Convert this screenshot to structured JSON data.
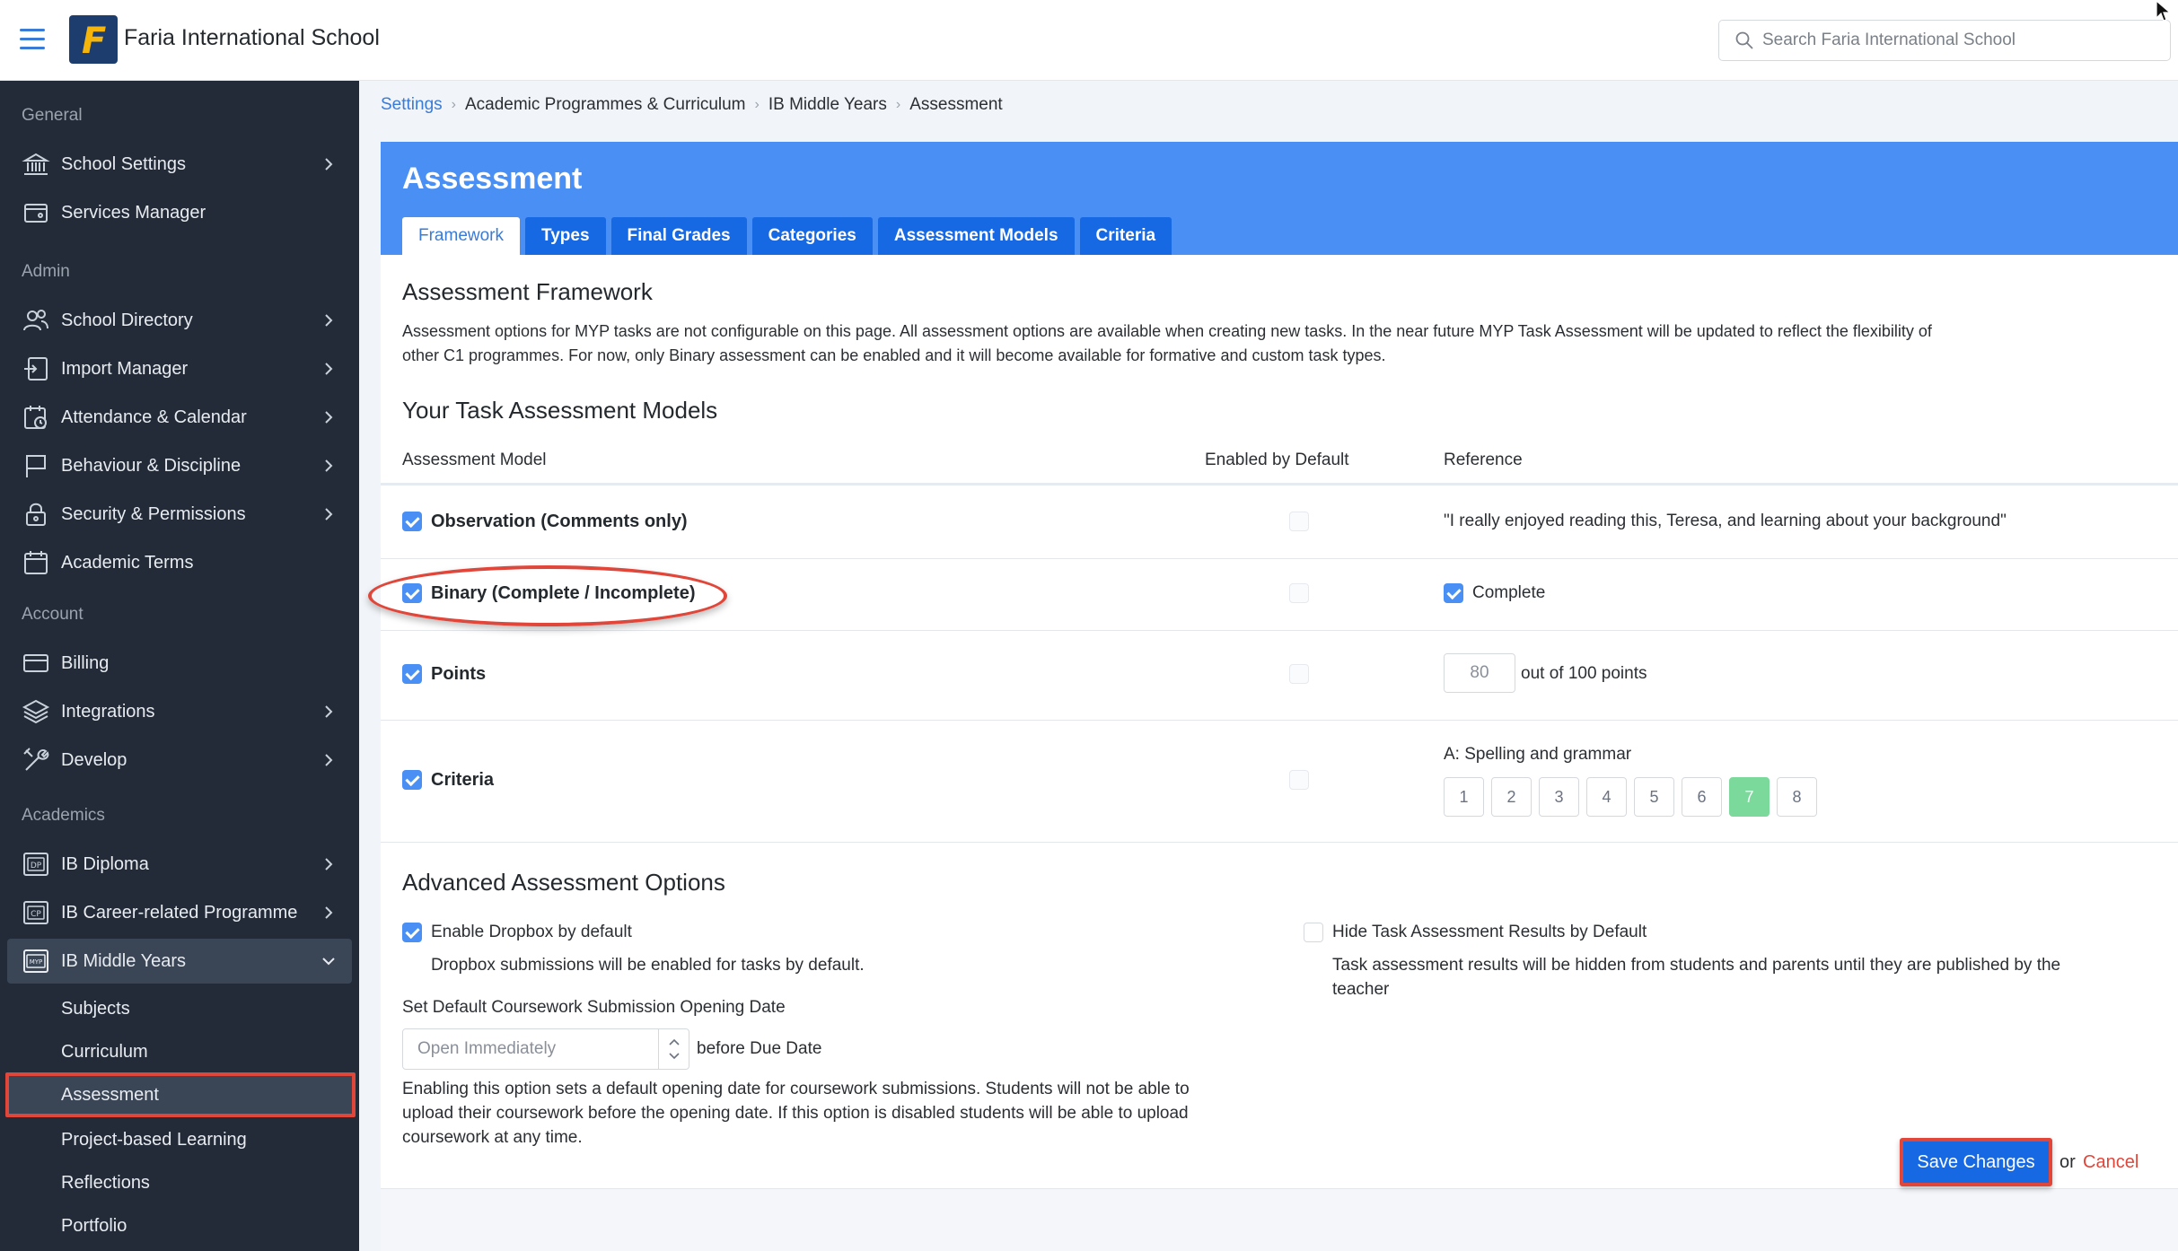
{
  "app": {
    "school_name": "Faria International School",
    "search_placeholder": "Search Faria International School"
  },
  "sidebar": {
    "sections": {
      "general": "General",
      "admin": "Admin",
      "account": "Account",
      "academics": "Academics"
    },
    "items": {
      "school_settings": "School Settings",
      "services_manager": "Services Manager",
      "school_directory": "School Directory",
      "import_manager": "Import Manager",
      "attendance_calendar": "Attendance & Calendar",
      "behaviour_discipline": "Behaviour & Discipline",
      "security_permissions": "Security & Permissions",
      "academic_terms": "Academic Terms",
      "billing": "Billing",
      "integrations": "Integrations",
      "develop": "Develop",
      "ib_diploma": "IB Diploma",
      "ib_career": "IB Career-related Programme",
      "ib_middle_years": "IB Middle Years"
    },
    "badges": {
      "dp": "DP",
      "cp": "CP",
      "myp": "MYP"
    },
    "subitems": {
      "subjects": "Subjects",
      "curriculum": "Curriculum",
      "assessment": "Assessment",
      "project_based": "Project-based Learning",
      "reflections": "Reflections",
      "portfolio": "Portfolio"
    }
  },
  "breadcrumb": {
    "settings": "Settings",
    "academic": "Academic Programmes & Curriculum",
    "ib_myp": "IB Middle Years",
    "current": "Assessment"
  },
  "page": {
    "title": "Assessment",
    "tabs": [
      "Framework",
      "Types",
      "Final Grades",
      "Categories",
      "Assessment Models",
      "Criteria"
    ],
    "framework_heading": "Assessment Framework",
    "framework_text_1": "Assessment options for MYP tasks are not configurable on this page. All assessment options are available when creating new tasks. In the near future MYP Task Assessment will be updated to reflect the flexibility of",
    "framework_text_2": "other C1 programmes. For now, only Binary assessment can be enabled and it will become available for formative and custom task types.",
    "models_heading": "Your Task Assessment Models",
    "columns": {
      "model": "Assessment Model",
      "enabled": "Enabled by Default",
      "reference": "Reference"
    },
    "models": {
      "observation": {
        "label": "Observation (Comments only)",
        "reference": "\"I really enjoyed reading this, Teresa, and learning about your background\""
      },
      "binary": {
        "label": "Binary (Complete / Incomplete)",
        "reference": "Complete"
      },
      "points": {
        "label": "Points",
        "value": "80",
        "suffix": "out of 100 points"
      },
      "criteria": {
        "label": "Criteria",
        "criterion": "A: Spelling and grammar",
        "grades": [
          "1",
          "2",
          "3",
          "4",
          "5",
          "6",
          "7",
          "8"
        ],
        "selected_grade": "7"
      }
    },
    "advanced": {
      "heading": "Advanced Assessment Options",
      "dropbox_label": "Enable Dropbox by default",
      "dropbox_help": "Dropbox submissions will be enabled for tasks by default.",
      "opening_label": "Set Default Coursework Submission Opening Date",
      "opening_placeholder": "Open Immediately",
      "opening_suffix": "before Due Date",
      "opening_help_1": "Enabling this option sets a default opening date for coursework submissions. Students will not be able to",
      "opening_help_2": "upload their coursework before the opening date. If this option is disabled students will be able to upload",
      "opening_help_3": "coursework at any time.",
      "hide_label": "Hide Task Assessment Results by Default",
      "hide_help_1": "Task assessment results will be hidden from students and parents until they are published by the",
      "hide_help_2": "teacher"
    },
    "footer": {
      "save": "Save Changes",
      "or": "or",
      "cancel": "Cancel"
    }
  },
  "colors": {
    "accent": "#4a8ff4",
    "tab_blue": "#1668e3",
    "sidebar": "#232b38",
    "highlight": "#e0463a",
    "grade_selected": "#7bd99c"
  }
}
